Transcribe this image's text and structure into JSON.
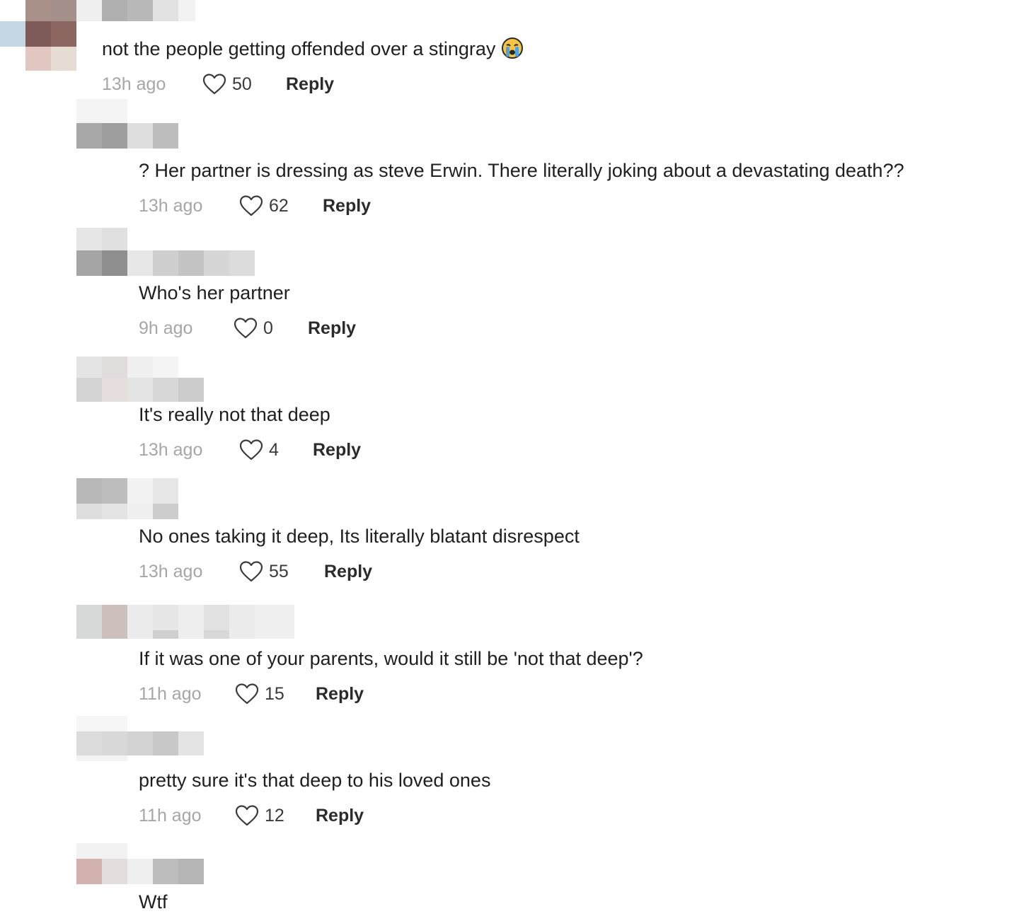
{
  "comments": [
    {
      "text": "not the people getting offended over a stingray",
      "emoji": "crying-emoji",
      "time": "13h ago",
      "likes": "50",
      "reply_label": "Reply"
    },
    {
      "text": "? Her partner is dressing as steve Erwin. There literally joking about a devastating death??",
      "time": "13h ago",
      "likes": "62",
      "reply_label": "Reply"
    },
    {
      "text": "Who's her partner",
      "time": "9h ago",
      "likes": "0",
      "reply_label": "Reply"
    },
    {
      "text": "It's really not that deep",
      "time": "13h ago",
      "likes": "4",
      "reply_label": "Reply"
    },
    {
      "text": "No ones taking it deep, Its literally blatant disrespect",
      "time": "13h ago",
      "likes": "55",
      "reply_label": "Reply"
    },
    {
      "text": "If it was one of your parents, would it still be 'not that deep'?",
      "time": "11h ago",
      "likes": "15",
      "reply_label": "Reply"
    },
    {
      "text": "pretty sure it's that deep to his loved ones",
      "time": "11h ago",
      "likes": "12",
      "reply_label": "Reply"
    },
    {
      "text": "Wtf"
    }
  ],
  "colors": {
    "like_icon": "#3a3a3a",
    "timestamp": "#a6a6a6",
    "reply": "#2b2b2b"
  },
  "icons": {
    "like": "heart-outline-icon"
  }
}
